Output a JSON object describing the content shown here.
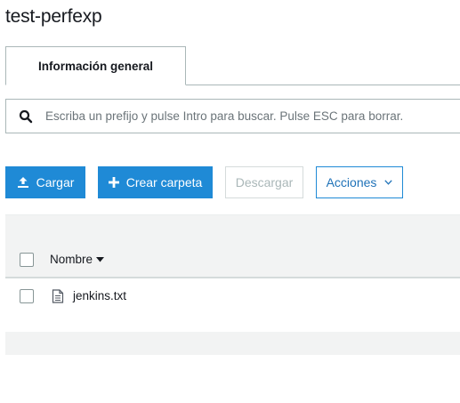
{
  "bucket": {
    "title": "test-perfexp"
  },
  "tabs": [
    {
      "label": "Información general",
      "active": true
    }
  ],
  "search": {
    "placeholder": "Escriba un prefijo y pulse Intro para buscar. Pulse ESC para borrar.",
    "value": ""
  },
  "toolbar": {
    "upload_label": "Cargar",
    "create_folder_label": "Crear carpeta",
    "download_label": "Descargar",
    "actions_label": "Acciones"
  },
  "table": {
    "columns": [
      {
        "label": "Nombre",
        "sort": "descending"
      }
    ],
    "rows": [
      {
        "name": "jenkins.txt",
        "type": "file"
      }
    ]
  },
  "colors": {
    "primary": "#1f8ad6",
    "primary_text": "#ffffff",
    "disabled_text": "#aab7b8",
    "band": "#f2f3f3"
  },
  "icons": {
    "search": "search-icon",
    "upload": "upload-icon",
    "create_folder": "plus-icon",
    "actions": "chevron-down-icon",
    "sort": "caret-down-icon",
    "file": "file-icon"
  }
}
